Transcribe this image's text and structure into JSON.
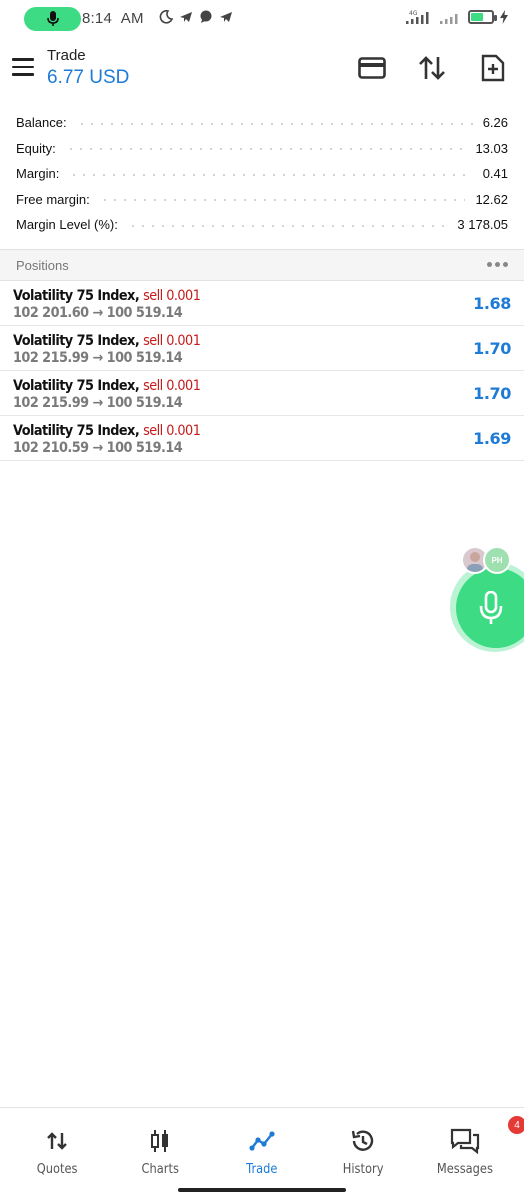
{
  "status_bar": {
    "time": "8:14",
    "ampm": "AM",
    "network_label": "4G",
    "battery_label": "58",
    "battery_level": 0.58
  },
  "header": {
    "title": "Trade",
    "balance_display": "6.77 USD"
  },
  "summary": [
    {
      "label": "Balance:",
      "value": "6.26"
    },
    {
      "label": "Equity:",
      "value": "13.03"
    },
    {
      "label": "Margin:",
      "value": "0.41"
    },
    {
      "label": "Free margin:",
      "value": "12.62"
    },
    {
      "label": "Margin Level (%):",
      "value": "3 178.05"
    }
  ],
  "positions": {
    "header": "Positions",
    "items": [
      {
        "symbol": "Volatility 75 Index",
        "side": "sell 0.001",
        "open_price": "102 201.60",
        "current_price": "100 519.14",
        "profit": "1.68"
      },
      {
        "symbol": "Volatility 75 Index",
        "side": "sell 0.001",
        "open_price": "102 215.99",
        "current_price": "100 519.14",
        "profit": "1.70"
      },
      {
        "symbol": "Volatility 75 Index",
        "side": "sell 0.001",
        "open_price": "102 215.99",
        "current_price": "100 519.14",
        "profit": "1.70"
      },
      {
        "symbol": "Volatility 75 Index",
        "side": "sell 0.001",
        "open_price": "102 210.59",
        "current_price": "100 519.14",
        "profit": "1.69"
      }
    ]
  },
  "voice_bubble": {
    "avatar_initials": "PH"
  },
  "bottom_nav": {
    "items": [
      {
        "label": "Quotes",
        "icon": "quotes-icon"
      },
      {
        "label": "Charts",
        "icon": "charts-icon"
      },
      {
        "label": "Trade",
        "icon": "trade-icon",
        "active": true
      },
      {
        "label": "History",
        "icon": "history-icon"
      },
      {
        "label": "Messages",
        "icon": "messages-icon",
        "badge": "4"
      }
    ]
  },
  "colors": {
    "accent": "#1e7bd6",
    "sell": "#c61b1b",
    "green": "#3ddc84",
    "badge": "#e53935"
  }
}
